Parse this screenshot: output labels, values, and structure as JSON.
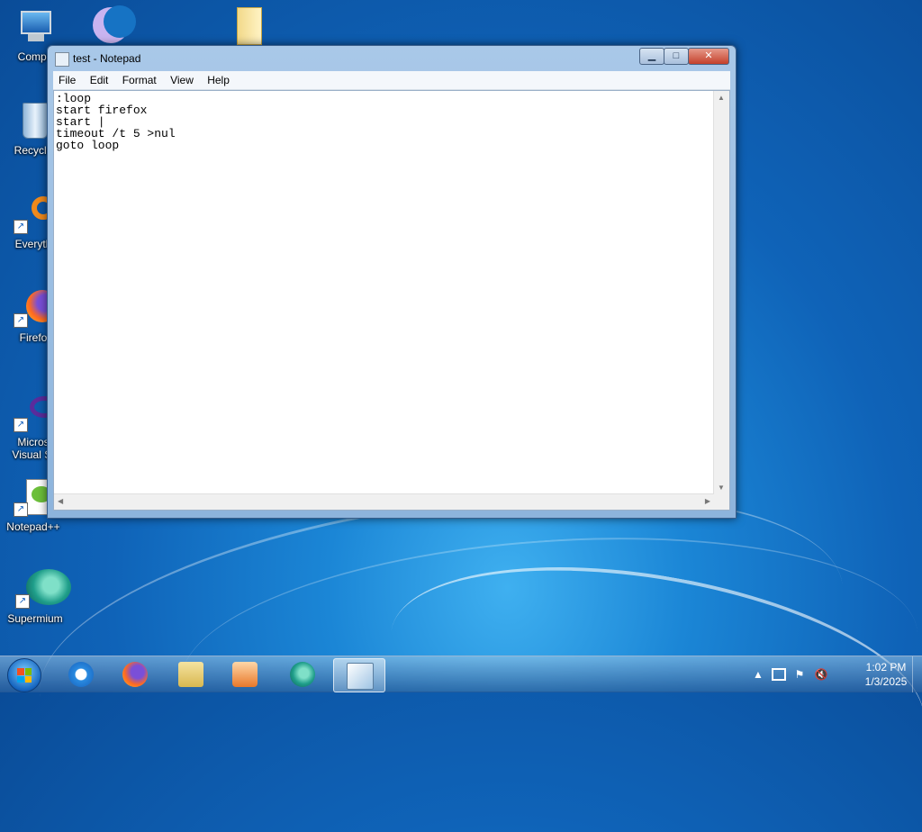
{
  "desktop": {
    "icons": [
      {
        "label": "Compu",
        "icon": "computer-icon"
      },
      {
        "label": "",
        "icon": "moon-app-icon"
      },
      {
        "label": "",
        "icon": "folder-icon"
      },
      {
        "label": "Recycle",
        "icon": "recycle-bin-icon"
      },
      {
        "label": "Everyth",
        "icon": "everything-search-icon"
      },
      {
        "label": "Firefo",
        "icon": "firefox-icon"
      },
      {
        "label": "Micros\nVisual St",
        "icon": "visual-studio-icon"
      },
      {
        "label": "Notepad++",
        "icon": "notepadpp-icon"
      },
      {
        "label": "Supermium",
        "icon": "supermium-icon"
      }
    ]
  },
  "window": {
    "title": "test - Notepad",
    "controls": {
      "minimize": "▁",
      "maximize": "□",
      "close": "✕"
    },
    "menu": [
      "File",
      "Edit",
      "Format",
      "View",
      "Help"
    ],
    "content": ":loop\nstart firefox\nstart |\ntimeout /t 5 >nul\ngoto loop"
  },
  "taskbar": {
    "apps": [
      "internet-explorer-icon",
      "firefox-icon",
      "file-explorer-icon",
      "media-player-icon",
      "supermium-icon",
      "notepad-icon"
    ],
    "active_app": "notepad-icon",
    "tray": {
      "overflow": "▲",
      "time": "1:02 PM",
      "date": "1/3/2025"
    }
  }
}
